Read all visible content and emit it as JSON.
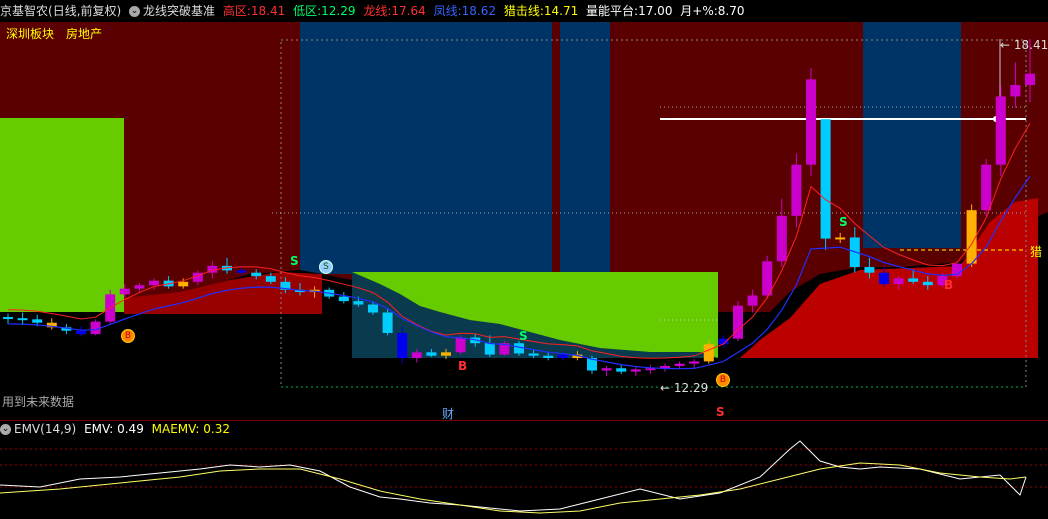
{
  "header": {
    "stock_name": "京基智农",
    "period": "(日线,前复权)",
    "indicator_name": "龙线突破基准",
    "high_zone_label": "高区:",
    "high_zone_value": "18.41",
    "low_zone_label": "低区:",
    "low_zone_value": "12.29",
    "dragon_line_label": "龙线:",
    "dragon_line_value": "17.64",
    "phoenix_line_label": "凤线:",
    "phoenix_line_value": "18.62",
    "hunt_line_label": "猎击线:",
    "hunt_line_value": "14.71",
    "volume_platform_label": "量能平台:",
    "volume_platform_value": "17.00",
    "month_pct_label": "月+%:",
    "month_pct_value": "8.70"
  },
  "sector": {
    "label1": "深圳板块",
    "label2": "房地产"
  },
  "annotations": {
    "high_price": "18.41",
    "low_price": "12.29",
    "future_data_note": "用到未来数据",
    "finance_mark": "财",
    "hunt_mark": "猎",
    "signal_s": "S",
    "signal_b": "B"
  },
  "sub_indicator": {
    "name": "EMV(14,9)",
    "emv_label": "EMV:",
    "emv_value": "0.49",
    "maemv_label": "MAEMV:",
    "maemv_value": "0.32"
  },
  "colors": {
    "up": "#cc00cc",
    "down": "#00ccff",
    "neutral_yellow": "#ffb000",
    "dark_blue": "#0000ee",
    "bg_red": "#5a0000",
    "bg_blue": "#003366",
    "bg_green": "#66cc00",
    "fill_red": "#990000",
    "text_red": "#ff3030",
    "text_green": "#00ff66",
    "text_yellow": "#ffff00",
    "text_blue": "#3366ff"
  },
  "chart_data": {
    "type": "candlestick",
    "x": [
      "d1",
      "d2",
      "d3",
      "d4",
      "d5",
      "d6",
      "d7",
      "d8",
      "d9",
      "d10",
      "d11",
      "d12",
      "d13",
      "d14",
      "d15",
      "d16",
      "d17",
      "d18",
      "d19",
      "d20",
      "d21",
      "d22",
      "d23",
      "d24",
      "d25",
      "d26",
      "d27",
      "d28",
      "d29",
      "d30",
      "d31",
      "d32",
      "d33",
      "d34",
      "d35",
      "d36",
      "d37",
      "d38",
      "d39",
      "d40",
      "d41",
      "d42",
      "d43",
      "d44",
      "d45",
      "d46",
      "d47",
      "d48",
      "d49",
      "d50",
      "d51",
      "d52",
      "d53",
      "d54",
      "d55",
      "d56",
      "d57",
      "d58",
      "d59",
      "d60",
      "d61",
      "d62",
      "d63",
      "d64",
      "d65",
      "d66",
      "d67",
      "d68",
      "d69",
      "d70",
      "d71"
    ],
    "ohlc": [
      [
        13.52,
        13.58,
        13.4,
        13.5
      ],
      [
        13.5,
        13.6,
        13.38,
        13.48
      ],
      [
        13.48,
        13.56,
        13.36,
        13.42
      ],
      [
        13.42,
        13.5,
        13.3,
        13.34
      ],
      [
        13.34,
        13.4,
        13.22,
        13.28
      ],
      [
        13.28,
        13.36,
        13.18,
        13.22
      ],
      [
        13.22,
        13.48,
        13.2,
        13.44
      ],
      [
        13.44,
        14.0,
        13.4,
        13.92
      ],
      [
        13.92,
        14.1,
        13.86,
        14.02
      ],
      [
        14.02,
        14.12,
        13.96,
        14.08
      ],
      [
        14.08,
        14.2,
        14.0,
        14.16
      ],
      [
        14.16,
        14.24,
        14.02,
        14.06
      ],
      [
        14.06,
        14.2,
        14.02,
        14.14
      ],
      [
        14.14,
        14.34,
        14.08,
        14.3
      ],
      [
        14.3,
        14.5,
        14.2,
        14.42
      ],
      [
        14.42,
        14.56,
        14.28,
        14.34
      ],
      [
        14.34,
        14.4,
        14.26,
        14.3
      ],
      [
        14.3,
        14.36,
        14.18,
        14.24
      ],
      [
        14.24,
        14.3,
        14.1,
        14.14
      ],
      [
        14.14,
        14.22,
        13.94,
        14.0
      ],
      [
        14.0,
        14.12,
        13.9,
        13.96
      ],
      [
        13.96,
        14.06,
        13.86,
        14.0
      ],
      [
        14.0,
        14.04,
        13.84,
        13.88
      ],
      [
        13.88,
        13.96,
        13.76,
        13.8
      ],
      [
        13.8,
        13.88,
        13.7,
        13.74
      ],
      [
        13.74,
        13.8,
        13.56,
        13.6
      ],
      [
        13.6,
        13.66,
        13.2,
        13.24
      ],
      [
        13.24,
        13.36,
        12.7,
        12.8
      ],
      [
        12.8,
        12.96,
        12.72,
        12.9
      ],
      [
        12.9,
        12.96,
        12.82,
        12.84
      ],
      [
        12.84,
        12.96,
        12.78,
        12.9
      ],
      [
        12.9,
        13.2,
        12.86,
        13.16
      ],
      [
        13.16,
        13.22,
        13.0,
        13.06
      ],
      [
        13.06,
        13.2,
        12.82,
        12.86
      ],
      [
        12.86,
        13.1,
        12.84,
        13.06
      ],
      [
        13.06,
        13.1,
        12.84,
        12.88
      ],
      [
        12.88,
        12.96,
        12.8,
        12.84
      ],
      [
        12.84,
        12.9,
        12.76,
        12.8
      ],
      [
        12.8,
        12.9,
        12.76,
        12.86
      ],
      [
        12.86,
        12.92,
        12.76,
        12.8
      ],
      [
        12.8,
        12.84,
        12.52,
        12.58
      ],
      [
        12.58,
        12.66,
        12.48,
        12.62
      ],
      [
        12.62,
        12.68,
        12.52,
        12.56
      ],
      [
        12.56,
        12.64,
        12.48,
        12.6
      ],
      [
        12.6,
        12.68,
        12.52,
        12.62
      ],
      [
        12.62,
        12.7,
        12.56,
        12.66
      ],
      [
        12.66,
        12.74,
        12.6,
        12.7
      ],
      [
        12.7,
        12.78,
        12.62,
        12.74
      ],
      [
        12.74,
        13.1,
        12.7,
        13.04
      ],
      [
        13.04,
        13.2,
        12.98,
        13.14
      ],
      [
        13.14,
        13.8,
        13.1,
        13.72
      ],
      [
        13.72,
        14.0,
        13.6,
        13.9
      ],
      [
        13.9,
        14.6,
        13.84,
        14.5
      ],
      [
        14.5,
        15.6,
        14.4,
        15.3
      ],
      [
        15.3,
        16.4,
        15.1,
        16.2
      ],
      [
        16.2,
        17.9,
        16.0,
        17.7
      ],
      [
        17.0,
        16.4,
        14.7,
        14.9
      ],
      [
        14.9,
        15.0,
        14.82,
        14.92
      ],
      [
        14.92,
        15.1,
        14.3,
        14.4
      ],
      [
        14.4,
        14.56,
        14.2,
        14.3
      ],
      [
        14.3,
        14.4,
        14.06,
        14.1
      ],
      [
        14.1,
        14.24,
        14.0,
        14.2
      ],
      [
        14.2,
        14.36,
        14.1,
        14.14
      ],
      [
        14.14,
        14.24,
        14.0,
        14.08
      ],
      [
        14.08,
        14.3,
        14.04,
        14.24
      ],
      [
        14.24,
        14.5,
        14.2,
        14.46
      ],
      [
        14.46,
        15.5,
        14.4,
        15.4
      ],
      [
        15.4,
        16.3,
        15.3,
        16.2
      ],
      [
        16.2,
        17.6,
        16.0,
        17.4
      ],
      [
        17.4,
        18.0,
        17.2,
        17.6
      ],
      [
        17.6,
        18.41,
        17.3,
        17.8
      ]
    ],
    "high_zone": 18.41,
    "low_zone": 12.29,
    "dragon_line": 17.64,
    "phoenix_line": 18.62,
    "hunt_line": 14.71,
    "ylim": [
      12.0,
      18.8
    ]
  }
}
